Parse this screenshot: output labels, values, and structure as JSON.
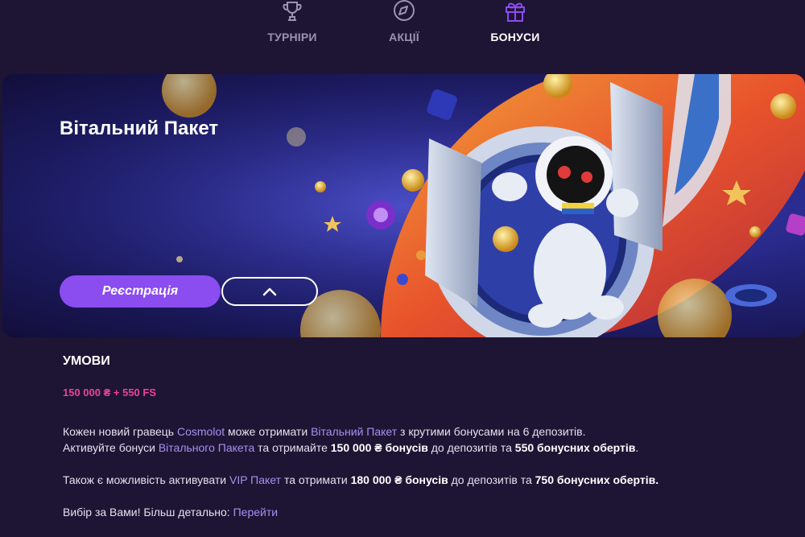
{
  "nav": {
    "items": [
      {
        "label": "ТУРНІРИ",
        "icon": "trophy-icon"
      },
      {
        "label": "АКЦІЇ",
        "icon": "compass-icon"
      },
      {
        "label": "БОНУСИ",
        "icon": "gift-icon"
      }
    ],
    "active": "БОНУСИ"
  },
  "banner": {
    "title": "Вітальний Пакет",
    "register_label": "Реєстрація",
    "toggle_icon": "chevron-up-icon"
  },
  "conditions": {
    "title": "УМОВИ",
    "offer": "150 000 ₴ + 550 FS",
    "p1": {
      "a": "Кожен новий гравець ",
      "link1": "Cosmolot",
      "b": " може отримати ",
      "link2": "Вітальний Пакет",
      "c": " з крутими бонусами на 6 депозитів."
    },
    "p1_line2": {
      "a": "Активуйте бонуси ",
      "link": "Вітального Пакета",
      "b": " та отримайте ",
      "bold1": "150 000 ₴ бонусів",
      "c": " до депозитів та ",
      "bold2": "550 бонусних обертів",
      "d": "."
    },
    "p2": {
      "a": "Також є можливість активувати ",
      "link": "VIP Пакет",
      "b": " та отримати ",
      "bold1": "180 000 ₴ бонусів",
      "c": " до депозитів та ",
      "bold2": "750 бонусних обертів."
    },
    "p3": {
      "a": "Вибір за Вами! Більш детально: ",
      "link": "Перейти"
    }
  },
  "colors": {
    "background": "#1e1433",
    "accent": "#8b4cf0",
    "offer": "#e8459a",
    "link": "#a98ff0"
  }
}
